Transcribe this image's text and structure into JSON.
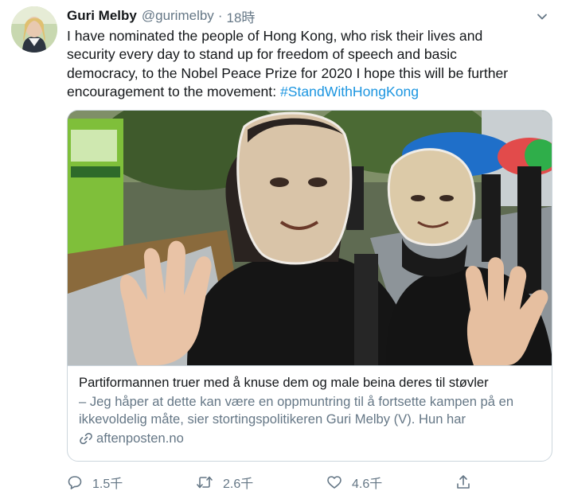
{
  "tweet": {
    "author_name": "Guri Melby",
    "handle": "@gurimelby",
    "separator": "·",
    "time": "18時",
    "text": "I have nominated the people of Hong Kong, who risk their lives and\nsecurity every day to stand up for freedom of speech and basic\ndemocracy, to the Nobel Peace Prize for 2020 I hope this will be further\nencouragement to the movement: ",
    "hashtag": "#StandWithHongKong"
  },
  "card": {
    "title": "Partiformannen truer med å knuse dem og male beina deres til støvler",
    "description": "– Jeg håper at dette kan være en oppmuntring til å fortsette kampen på en ikkevoldelig måte, sier stortingspolitikeren Guri Melby (V). Hun har",
    "domain": "aftenposten.no"
  },
  "actions": {
    "reply_count": "1.5千",
    "retweet_count": "2.6千",
    "like_count": "4.6千"
  },
  "icons": {
    "caret": "chevron-down-icon",
    "link": "link-icon",
    "reply": "reply-icon",
    "retweet": "retweet-icon",
    "like": "heart-icon",
    "share": "share-icon"
  },
  "colors": {
    "link": "#1b95e0",
    "secondary_text": "#657786",
    "border": "#ccd6dd"
  }
}
